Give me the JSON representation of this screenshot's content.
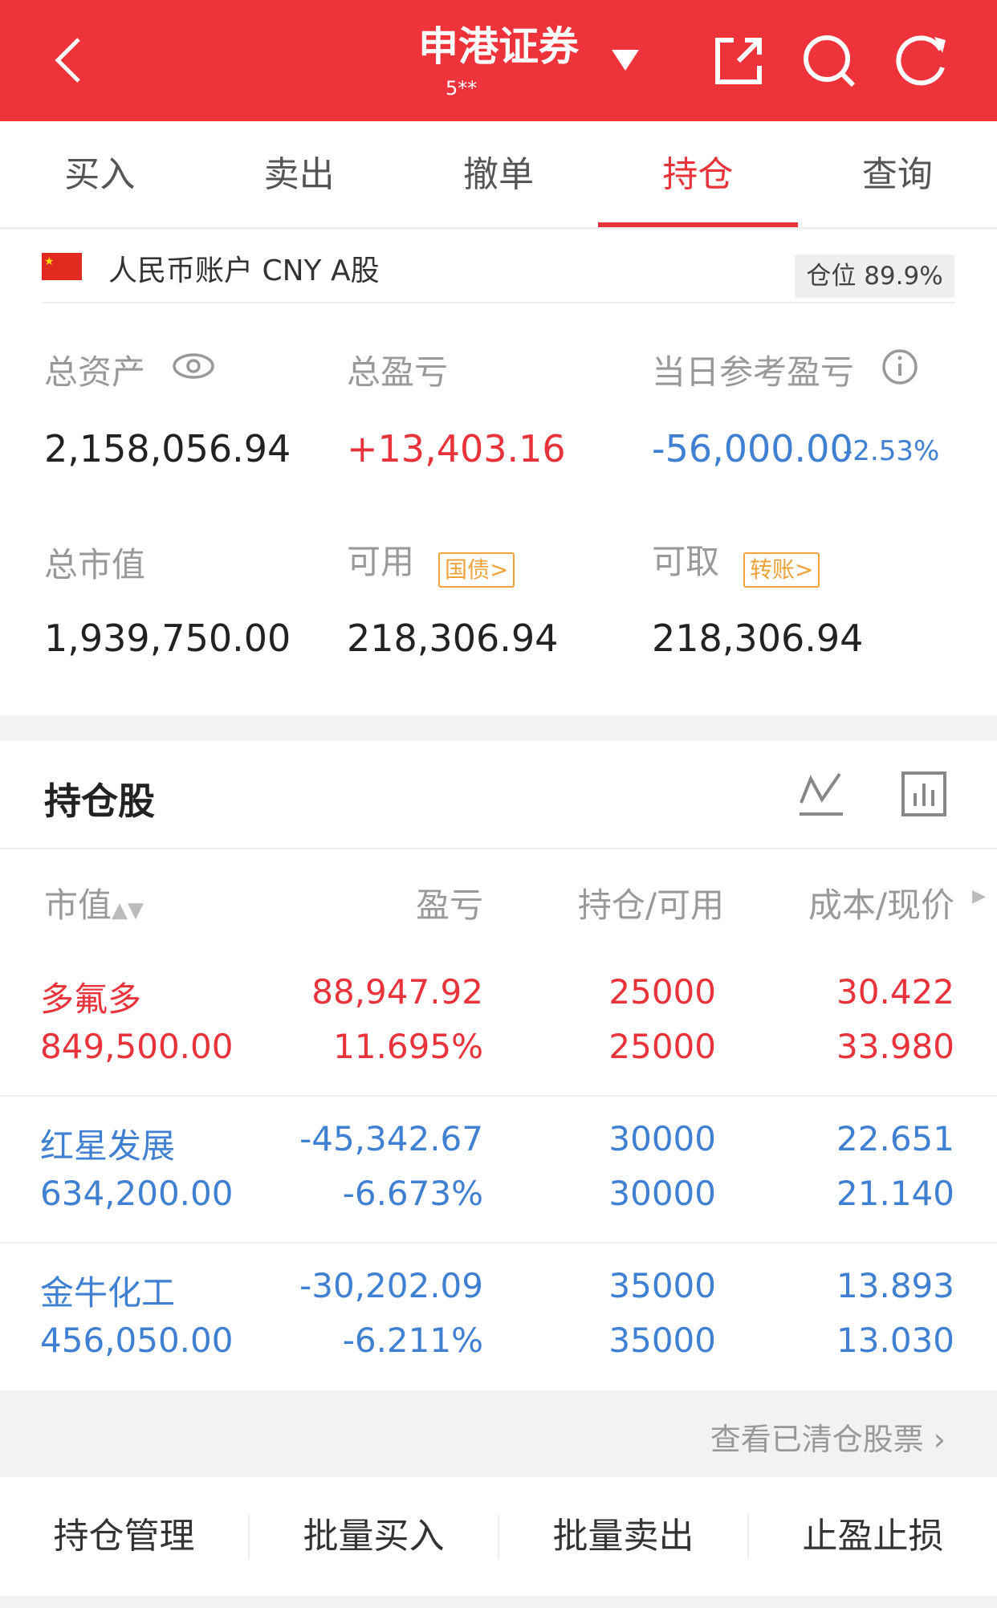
{
  "header": {
    "title": "申港证券",
    "subtitle": "5**"
  },
  "tabs": [
    "买入",
    "卖出",
    "撤单",
    "持仓",
    "查询"
  ],
  "account": {
    "name": "人民币账户 CNY A股",
    "position_label": "仓位",
    "position_value": "89.9%"
  },
  "summary": {
    "total_assets_label": "总资产",
    "total_assets": "2,158,056.94",
    "total_pl_label": "总盈亏",
    "total_pl": "+13,403.16",
    "daily_pl_label": "当日参考盈亏",
    "daily_pl": "-56,000.00",
    "daily_pl_pct": "-2.53%",
    "market_value_label": "总市值",
    "market_value": "1,939,750.00",
    "available_label": "可用",
    "available_tag": "国债>",
    "available": "218,306.94",
    "withdrawable_label": "可取",
    "withdrawable_tag": "转账>",
    "withdrawable": "218,306.94"
  },
  "holdings": {
    "title": "持仓股",
    "columns": [
      "市值",
      "盈亏",
      "持仓/可用",
      "成本/现价"
    ],
    "rows": [
      {
        "name": "多氟多",
        "value": "849,500.00",
        "pl": "88,947.92",
        "pl_pct": "11.695%",
        "hold": "25000",
        "avail": "25000",
        "cost": "30.422",
        "price": "33.980",
        "trend": "up"
      },
      {
        "name": "红星发展",
        "value": "634,200.00",
        "pl": "-45,342.67",
        "pl_pct": "-6.673%",
        "hold": "30000",
        "avail": "30000",
        "cost": "22.651",
        "price": "21.140",
        "trend": "down"
      },
      {
        "name": "金牛化工",
        "value": "456,050.00",
        "pl": "-30,202.09",
        "pl_pct": "-6.211%",
        "hold": "35000",
        "avail": "35000",
        "cost": "13.893",
        "price": "13.030",
        "trend": "down"
      }
    ],
    "cleared_link": "查看已清仓股票"
  },
  "bottom": [
    "持仓管理",
    "批量买入",
    "批量卖出",
    "止盈止损"
  ]
}
